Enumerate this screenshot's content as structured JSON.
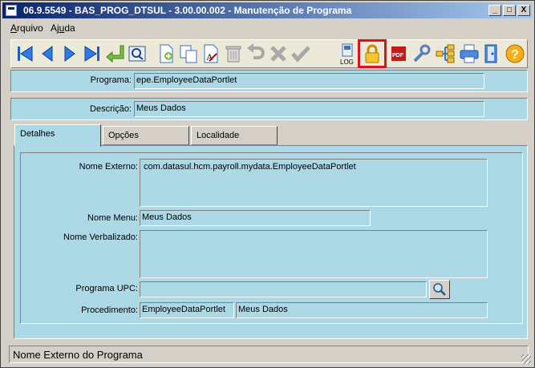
{
  "window": {
    "title": "06.9.5549 - BAS_PROG_DTSUL - 3.00.00.002 - Manutenção de Programa"
  },
  "window_buttons": {
    "minimize": "_",
    "maximize": "□",
    "close": "X"
  },
  "menu": {
    "items": [
      {
        "prefix": "",
        "key": "A",
        "rest": "rquivo"
      },
      {
        "prefix": "Aj",
        "key": "u",
        "rest": "da"
      }
    ]
  },
  "form": {
    "programa_label": "Programa:",
    "programa_value": "epe.EmployeeDataPortlet",
    "descricao_label": "Descrição:",
    "descricao_value": "Meus Dados"
  },
  "tabs": [
    {
      "label": "Detalhes",
      "active": true
    },
    {
      "label": "Opções",
      "active": false
    },
    {
      "label": "Localidade",
      "active": false
    }
  ],
  "details": {
    "nome_externo_label": "Nome Externo:",
    "nome_externo_value": "com.datasul.hcm.payroll.mydata.EmployeeDataPortlet",
    "nome_menu_label": "Nome Menu:",
    "nome_menu_value": "Meus Dados",
    "nome_verbalizado_label": "Nome Verbalizado:",
    "nome_verbalizado_value": "",
    "programa_upc_label": "Programa UPC:",
    "programa_upc_value": "",
    "procedimento_label": "Procedimento:",
    "procedimento_value": "EmployeeDataPortlet",
    "procedimento_desc": "Meus Dados"
  },
  "toolbar": {
    "log_label": "LOG",
    "pdf_label": "PDF",
    "spell_label": "A",
    "help_label": "?"
  },
  "status": {
    "text": "Nome Externo do Programa"
  },
  "colors": {
    "panel": "#add8e6",
    "highlight": "#e0101a",
    "titlebar": "#0a246a"
  }
}
